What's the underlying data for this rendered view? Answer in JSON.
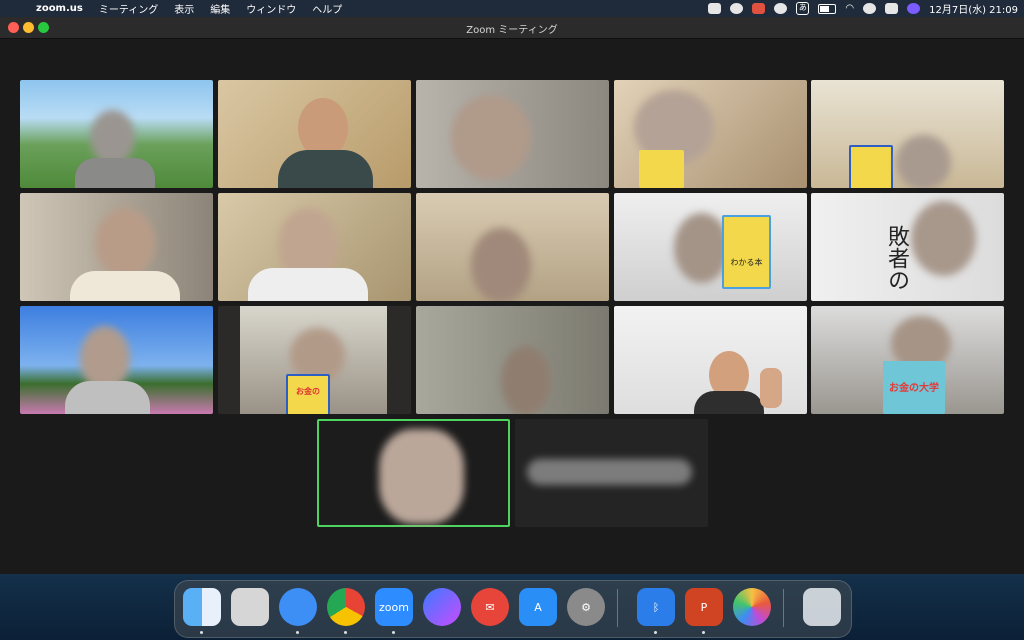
{
  "menubar": {
    "app_name": "zoom.us",
    "items": [
      "ミーティング",
      "表示",
      "編集",
      "ウィンドウ",
      "ヘルプ"
    ],
    "kana_input": "あ",
    "clock": "12月7日(水) 21:09"
  },
  "window": {
    "title": "Zoom ミーティング"
  },
  "gallery": {
    "participant_count": 17,
    "active_speaker_index": 15
  },
  "books": {
    "money_title": "お金の大学",
    "money_book_short": "お金の",
    "saving_book": "わかる本",
    "spine_text": "敗者の"
  },
  "dock": {
    "apps": [
      "finder-icon",
      "launchpad-icon",
      "safari-icon",
      "chrome-icon",
      "zoom-icon",
      "messenger-icon",
      "mail-icon",
      "app-store-icon",
      "system-settings-icon",
      "bluetooth-icon",
      "powerpoint-icon",
      "photos-icon",
      "trash-icon"
    ],
    "zoom_label": "zoom"
  }
}
